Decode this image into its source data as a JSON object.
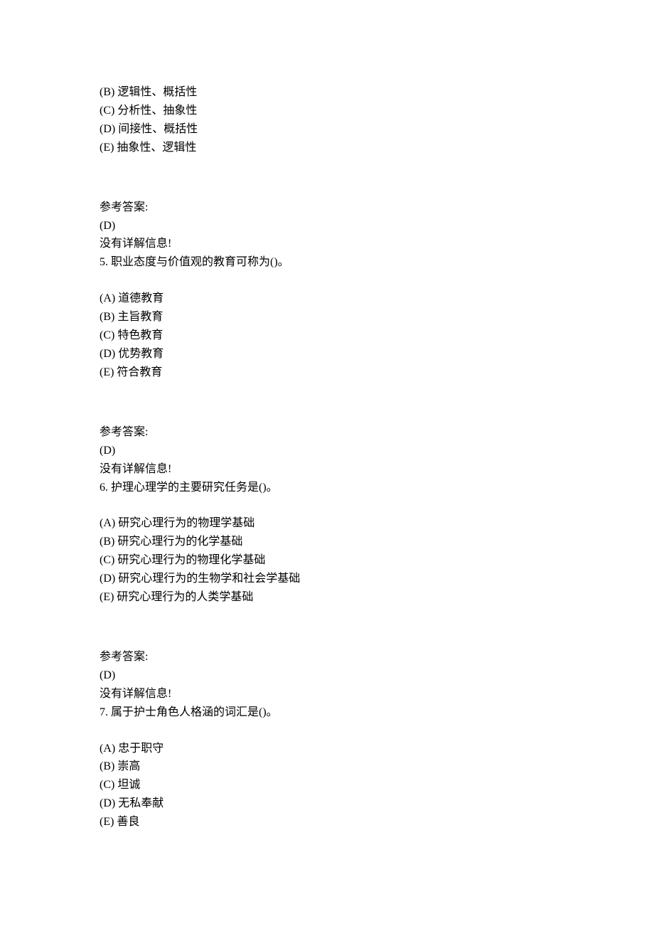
{
  "q4_continued": {
    "options": [
      "(B)  逻辑性、概括性",
      "(C)  分析性、抽象性",
      "(D)  间接性、概括性",
      "(E)  抽象性、逻辑性"
    ],
    "answer_label": "参考答案:",
    "answer": "(D)",
    "explain": "没有详解信息!"
  },
  "q5": {
    "stem": "5.    职业态度与价值观的教育可称为()。",
    "options": [
      "(A)  道德教育",
      "(B)  主旨教育",
      "(C)  特色教育",
      "(D)  优势教育",
      "(E)  符合教育"
    ],
    "answer_label": "参考答案:",
    "answer": "(D)",
    "explain": "没有详解信息!"
  },
  "q6": {
    "stem": "6.    护理心理学的主要研究任务是()。",
    "options": [
      "(A)  研究心理行为的物理学基础",
      "(B)  研究心理行为的化学基础",
      "(C)  研究心理行为的物理化学基础",
      "(D)  研究心理行为的生物学和社会学基础",
      "(E)  研究心理行为的人类学基础"
    ],
    "answer_label": "参考答案:",
    "answer": "(D)",
    "explain": "没有详解信息!"
  },
  "q7": {
    "stem": "7.    属于护士角色人格涵的词汇是()。",
    "options": [
      "(A)  忠于职守",
      "(B)  崇高",
      "(C)  坦诚",
      "(D)  无私奉献",
      "(E)  善良"
    ]
  }
}
